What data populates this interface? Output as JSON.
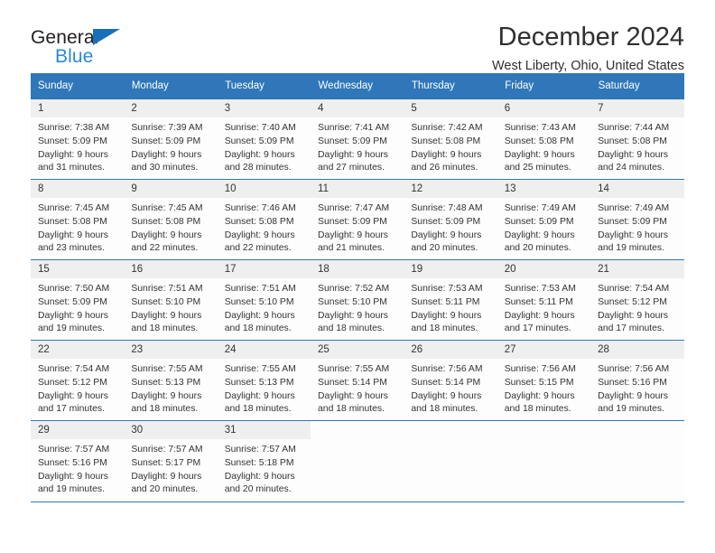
{
  "logo": {
    "word1": "General",
    "word2": "Blue",
    "triangle_color": "#1a70b8",
    "blue_text_color": "#2b8ad6"
  },
  "header": {
    "title": "December 2024",
    "subtitle": "West Liberty, Ohio, United States"
  },
  "theme": {
    "header_blue": "#2f77b8",
    "daynum_band": "#efefef",
    "cell_bg": "#fdfdfd",
    "text": "#333333"
  },
  "calendar": {
    "weekday_headers": [
      "Sunday",
      "Monday",
      "Tuesday",
      "Wednesday",
      "Thursday",
      "Friday",
      "Saturday"
    ],
    "weeks": [
      [
        {
          "day": "1",
          "sunrise": "Sunrise: 7:38 AM",
          "sunset": "Sunset: 5:09 PM",
          "daylight1": "Daylight: 9 hours",
          "daylight2": "and 31 minutes."
        },
        {
          "day": "2",
          "sunrise": "Sunrise: 7:39 AM",
          "sunset": "Sunset: 5:09 PM",
          "daylight1": "Daylight: 9 hours",
          "daylight2": "and 30 minutes."
        },
        {
          "day": "3",
          "sunrise": "Sunrise: 7:40 AM",
          "sunset": "Sunset: 5:09 PM",
          "daylight1": "Daylight: 9 hours",
          "daylight2": "and 28 minutes."
        },
        {
          "day": "4",
          "sunrise": "Sunrise: 7:41 AM",
          "sunset": "Sunset: 5:09 PM",
          "daylight1": "Daylight: 9 hours",
          "daylight2": "and 27 minutes."
        },
        {
          "day": "5",
          "sunrise": "Sunrise: 7:42 AM",
          "sunset": "Sunset: 5:08 PM",
          "daylight1": "Daylight: 9 hours",
          "daylight2": "and 26 minutes."
        },
        {
          "day": "6",
          "sunrise": "Sunrise: 7:43 AM",
          "sunset": "Sunset: 5:08 PM",
          "daylight1": "Daylight: 9 hours",
          "daylight2": "and 25 minutes."
        },
        {
          "day": "7",
          "sunrise": "Sunrise: 7:44 AM",
          "sunset": "Sunset: 5:08 PM",
          "daylight1": "Daylight: 9 hours",
          "daylight2": "and 24 minutes."
        }
      ],
      [
        {
          "day": "8",
          "sunrise": "Sunrise: 7:45 AM",
          "sunset": "Sunset: 5:08 PM",
          "daylight1": "Daylight: 9 hours",
          "daylight2": "and 23 minutes."
        },
        {
          "day": "9",
          "sunrise": "Sunrise: 7:45 AM",
          "sunset": "Sunset: 5:08 PM",
          "daylight1": "Daylight: 9 hours",
          "daylight2": "and 22 minutes."
        },
        {
          "day": "10",
          "sunrise": "Sunrise: 7:46 AM",
          "sunset": "Sunset: 5:08 PM",
          "daylight1": "Daylight: 9 hours",
          "daylight2": "and 22 minutes."
        },
        {
          "day": "11",
          "sunrise": "Sunrise: 7:47 AM",
          "sunset": "Sunset: 5:09 PM",
          "daylight1": "Daylight: 9 hours",
          "daylight2": "and 21 minutes."
        },
        {
          "day": "12",
          "sunrise": "Sunrise: 7:48 AM",
          "sunset": "Sunset: 5:09 PM",
          "daylight1": "Daylight: 9 hours",
          "daylight2": "and 20 minutes."
        },
        {
          "day": "13",
          "sunrise": "Sunrise: 7:49 AM",
          "sunset": "Sunset: 5:09 PM",
          "daylight1": "Daylight: 9 hours",
          "daylight2": "and 20 minutes."
        },
        {
          "day": "14",
          "sunrise": "Sunrise: 7:49 AM",
          "sunset": "Sunset: 5:09 PM",
          "daylight1": "Daylight: 9 hours",
          "daylight2": "and 19 minutes."
        }
      ],
      [
        {
          "day": "15",
          "sunrise": "Sunrise: 7:50 AM",
          "sunset": "Sunset: 5:09 PM",
          "daylight1": "Daylight: 9 hours",
          "daylight2": "and 19 minutes."
        },
        {
          "day": "16",
          "sunrise": "Sunrise: 7:51 AM",
          "sunset": "Sunset: 5:10 PM",
          "daylight1": "Daylight: 9 hours",
          "daylight2": "and 18 minutes."
        },
        {
          "day": "17",
          "sunrise": "Sunrise: 7:51 AM",
          "sunset": "Sunset: 5:10 PM",
          "daylight1": "Daylight: 9 hours",
          "daylight2": "and 18 minutes."
        },
        {
          "day": "18",
          "sunrise": "Sunrise: 7:52 AM",
          "sunset": "Sunset: 5:10 PM",
          "daylight1": "Daylight: 9 hours",
          "daylight2": "and 18 minutes."
        },
        {
          "day": "19",
          "sunrise": "Sunrise: 7:53 AM",
          "sunset": "Sunset: 5:11 PM",
          "daylight1": "Daylight: 9 hours",
          "daylight2": "and 18 minutes."
        },
        {
          "day": "20",
          "sunrise": "Sunrise: 7:53 AM",
          "sunset": "Sunset: 5:11 PM",
          "daylight1": "Daylight: 9 hours",
          "daylight2": "and 17 minutes."
        },
        {
          "day": "21",
          "sunrise": "Sunrise: 7:54 AM",
          "sunset": "Sunset: 5:12 PM",
          "daylight1": "Daylight: 9 hours",
          "daylight2": "and 17 minutes."
        }
      ],
      [
        {
          "day": "22",
          "sunrise": "Sunrise: 7:54 AM",
          "sunset": "Sunset: 5:12 PM",
          "daylight1": "Daylight: 9 hours",
          "daylight2": "and 17 minutes."
        },
        {
          "day": "23",
          "sunrise": "Sunrise: 7:55 AM",
          "sunset": "Sunset: 5:13 PM",
          "daylight1": "Daylight: 9 hours",
          "daylight2": "and 18 minutes."
        },
        {
          "day": "24",
          "sunrise": "Sunrise: 7:55 AM",
          "sunset": "Sunset: 5:13 PM",
          "daylight1": "Daylight: 9 hours",
          "daylight2": "and 18 minutes."
        },
        {
          "day": "25",
          "sunrise": "Sunrise: 7:55 AM",
          "sunset": "Sunset: 5:14 PM",
          "daylight1": "Daylight: 9 hours",
          "daylight2": "and 18 minutes."
        },
        {
          "day": "26",
          "sunrise": "Sunrise: 7:56 AM",
          "sunset": "Sunset: 5:14 PM",
          "daylight1": "Daylight: 9 hours",
          "daylight2": "and 18 minutes."
        },
        {
          "day": "27",
          "sunrise": "Sunrise: 7:56 AM",
          "sunset": "Sunset: 5:15 PM",
          "daylight1": "Daylight: 9 hours",
          "daylight2": "and 18 minutes."
        },
        {
          "day": "28",
          "sunrise": "Sunrise: 7:56 AM",
          "sunset": "Sunset: 5:16 PM",
          "daylight1": "Daylight: 9 hours",
          "daylight2": "and 19 minutes."
        }
      ],
      [
        {
          "day": "29",
          "sunrise": "Sunrise: 7:57 AM",
          "sunset": "Sunset: 5:16 PM",
          "daylight1": "Daylight: 9 hours",
          "daylight2": "and 19 minutes."
        },
        {
          "day": "30",
          "sunrise": "Sunrise: 7:57 AM",
          "sunset": "Sunset: 5:17 PM",
          "daylight1": "Daylight: 9 hours",
          "daylight2": "and 20 minutes."
        },
        {
          "day": "31",
          "sunrise": "Sunrise: 7:57 AM",
          "sunset": "Sunset: 5:18 PM",
          "daylight1": "Daylight: 9 hours",
          "daylight2": "and 20 minutes."
        },
        {
          "day": "",
          "sunrise": "",
          "sunset": "",
          "daylight1": "",
          "daylight2": ""
        },
        {
          "day": "",
          "sunrise": "",
          "sunset": "",
          "daylight1": "",
          "daylight2": ""
        },
        {
          "day": "",
          "sunrise": "",
          "sunset": "",
          "daylight1": "",
          "daylight2": ""
        },
        {
          "day": "",
          "sunrise": "",
          "sunset": "",
          "daylight1": "",
          "daylight2": ""
        }
      ]
    ]
  }
}
